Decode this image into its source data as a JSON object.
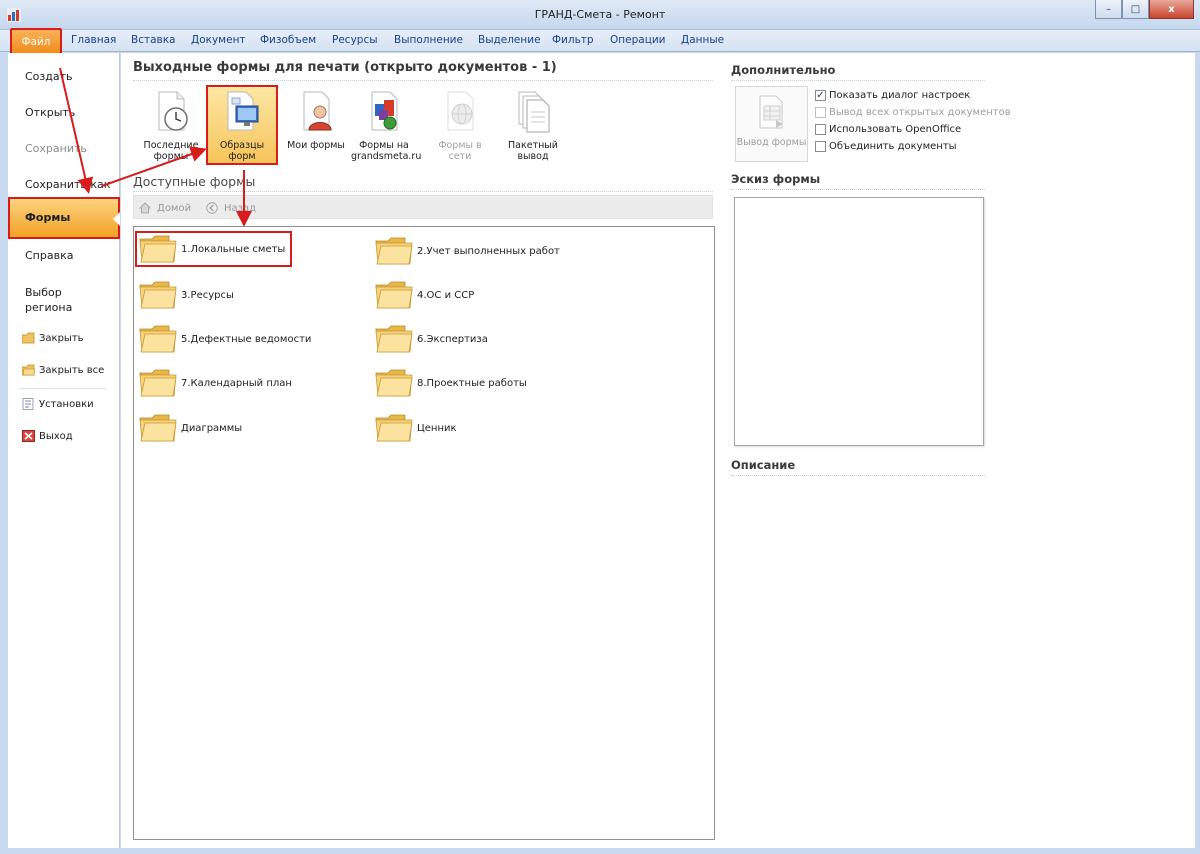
{
  "window": {
    "title": "ГРАНД-Смета - Ремонт",
    "minimize_icon": "minimize-icon",
    "maximize_icon": "maximize-icon",
    "close_icon": "close-icon",
    "minimize_glyph": "–",
    "maximize_glyph": "□",
    "close_glyph": "x"
  },
  "ribbon": {
    "file_tab": "Файл",
    "tabs": [
      "Главная",
      "Вставка",
      "Документ",
      "Физобъем",
      "Ресурсы",
      "Выполнение",
      "Выделение",
      "Фильтр",
      "Операции",
      "Данные"
    ]
  },
  "backstage_menu": {
    "create": "Создать",
    "open": "Открыть",
    "save": "Сохранить",
    "save_as": "Сохранить как",
    "forms": "Формы",
    "help": "Справка",
    "region_line1": "Выбор",
    "region_line2": "региона",
    "close": "Закрыть",
    "close_all": "Закрыть все",
    "settings": "Установки",
    "exit": "Выход"
  },
  "print_forms": {
    "title": "Выходные формы для печати (открыто документов - 1)",
    "buttons": [
      {
        "line1": "Последние",
        "line2": "формы"
      },
      {
        "line1": "Образцы",
        "line2": "форм"
      },
      {
        "line1": "Мои формы",
        "line2": ""
      },
      {
        "line1": "Формы на",
        "line2": "grandsmeta.ru"
      },
      {
        "line1": "Формы в сети",
        "line2": ""
      },
      {
        "line1": "Пакетный",
        "line2": "вывод"
      }
    ]
  },
  "available_forms": {
    "title": "Доступные формы",
    "home_label": "Домой",
    "back_label": "Назад",
    "folders": [
      "1.Локальные сметы",
      "2.Учет выполненных работ",
      "3.Ресурсы",
      "4.ОС и ССР",
      "5.Дефектные ведомости",
      "6.Экспертиза",
      "7.Календарный план",
      "8.Проектные работы",
      "Диаграммы",
      "Ценник"
    ]
  },
  "extra": {
    "title": "Дополнительно",
    "output_button": "Вывод формы",
    "options": [
      {
        "label": "Показать диалог настроек",
        "checked": "✓"
      },
      {
        "label": "Вывод всех открытых документов",
        "checked": ""
      },
      {
        "label": "Использовать OpenOffice",
        "checked": ""
      },
      {
        "label": "Объединить документы",
        "checked": ""
      }
    ],
    "sketch_title": "Эскиз формы",
    "description_title": "Описание"
  },
  "colors": {
    "accent_orange": "#f4a126",
    "annotation_red": "#d81c1c",
    "ribbon_text": "#15428b"
  }
}
